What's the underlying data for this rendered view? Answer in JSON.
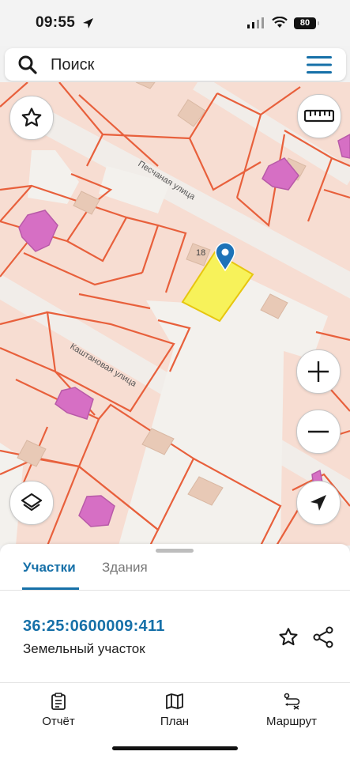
{
  "status_bar": {
    "time": "09:55",
    "battery": "80",
    "icons": [
      "location-arrow-icon",
      "signal-icon",
      "wifi-icon",
      "battery-icon"
    ]
  },
  "search": {
    "placeholder": "Поиск",
    "icons": [
      "search-icon",
      "menu-icon"
    ]
  },
  "map": {
    "street_labels": [
      "Песчаная улица",
      "Каштановая улица"
    ],
    "house_number": "18",
    "selected_parcel_color": "#f7f25a",
    "boundary_color": "#e8603c",
    "building_color": "#d66fc4",
    "marker_color": "#1e73b8",
    "controls": [
      "favorite-icon",
      "ruler-icon",
      "zoom-in-icon",
      "zoom-out-icon",
      "layers-icon",
      "navigation-arrow-icon"
    ]
  },
  "sheet": {
    "tabs": [
      {
        "label": "Участки",
        "active": true
      },
      {
        "label": "Здания",
        "active": false
      }
    ],
    "parcel": {
      "cadastral_number": "36:25:0600009:411",
      "type": "Земельный участок"
    },
    "actions": [
      "star-icon",
      "share-icon"
    ]
  },
  "bottom_nav": {
    "items": [
      {
        "label": "Отчёт",
        "icon": "report-icon"
      },
      {
        "label": "План",
        "icon": "map-plan-icon"
      },
      {
        "label": "Маршрут",
        "icon": "route-icon"
      }
    ]
  },
  "colors": {
    "accent": "#1670a8"
  }
}
